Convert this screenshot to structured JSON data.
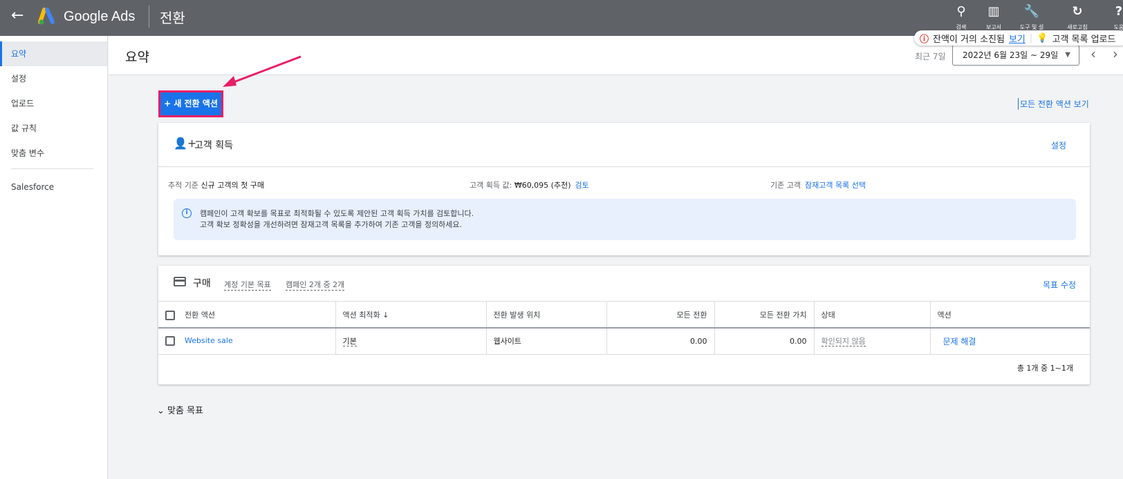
{
  "header": {
    "back_icon": "arrow-back-icon",
    "brand": "Google Ads",
    "page": "전환",
    "tools": [
      {
        "icon": "search-icon",
        "label": "검색"
      },
      {
        "icon": "reports-icon",
        "label": "보고서"
      },
      {
        "icon": "wrench-icon",
        "label": "도구 및 설"
      },
      {
        "icon": "refresh-icon",
        "label": "새로고침"
      },
      {
        "icon": "help-icon",
        "label": "도움"
      }
    ]
  },
  "notification": {
    "alert": "잔액이 거의 소진됨",
    "view": "보기",
    "upload": "고객 목록 업로드"
  },
  "sidebar": {
    "items": [
      {
        "label": "요약"
      },
      {
        "label": "설정"
      },
      {
        "label": "업로드"
      },
      {
        "label": "값 규칙"
      },
      {
        "label": "맞춤 변수"
      },
      {
        "label": "Salesforce"
      }
    ]
  },
  "titlebar": {
    "title": "요약",
    "range_label": "최근 7일",
    "date_range": "2022년 6월 23일 ~ 29일"
  },
  "new_action": "+ 새 전환 액션",
  "all_actions_link": "모든 전환 액션 보기",
  "acquisition": {
    "title": "고객 획득",
    "settings": "설정",
    "tracking_label": "추적 기준",
    "tracking_value": "신규 고객의 첫 구매",
    "value_label": "고객 획득 값:",
    "value": "₩60,095 (추천)",
    "review": "검토",
    "existing_label": "기존 고객",
    "existing_link": "잠재고객 목록 선택",
    "info_line1": "캠페인이 고객 확보를 목표로 최적화될 수 있도록 제안된 고객 획득 가치를 검토합니다.",
    "info_line2": "고객 확보 정확성을 개선하려면 잠재고객 목록을 추가하여 기존 고객을 정의하세요."
  },
  "purchase": {
    "title": "구매",
    "tag1": "계정 기본 목표",
    "tag2": "캠페인 2개 중 2개",
    "edit": "목표 수정",
    "columns": [
      "전환 액션",
      "액션 최적화",
      "전환 발생 위치",
      "모든 전환",
      "모든 전환 가치",
      "상태",
      "액션"
    ],
    "sort_icon": "arrow-down-icon",
    "rows": [
      {
        "action": "Website sale",
        "optimization": "기본",
        "source": "웹사이트",
        "all_conv": "0.00",
        "all_value": "0.00",
        "status": "확인되지 않음",
        "fix": "문제 해결"
      }
    ],
    "pagination": "총 1개 중 1~1개"
  },
  "custom_goals": "맞춤 목표",
  "colors": {
    "accent": "#1a73e8",
    "highlight": "#e91e63",
    "header": "#5f6368"
  }
}
